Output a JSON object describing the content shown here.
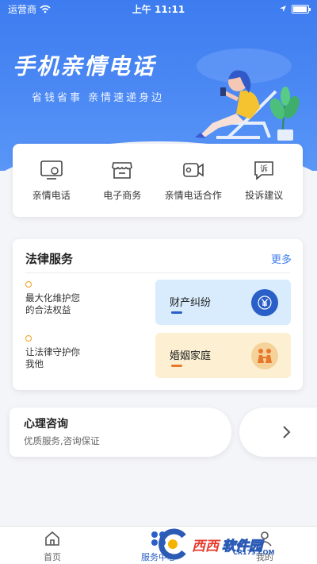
{
  "status_bar": {
    "carrier": "运营商",
    "time": "上午 11:11"
  },
  "hero": {
    "title": "手机亲情电话",
    "subtitle": "省钱省事  亲情速递身边"
  },
  "features": [
    {
      "label": "亲情电话",
      "icon": "tv-phone-icon"
    },
    {
      "label": "电子商务",
      "icon": "shop-icon"
    },
    {
      "label": "亲情电话合作",
      "icon": "video-camera-icon"
    },
    {
      "label": "投诉建议",
      "icon": "complaint-icon"
    }
  ],
  "legal": {
    "title": "法律服务",
    "more": "更多",
    "items": [
      {
        "text": "最大化维护您的合法权益"
      },
      {
        "text": "让法律守护你我他"
      }
    ],
    "pills": [
      {
        "label": "财产纠纷",
        "icon": "yen-icon",
        "bg": "#d8ecfd",
        "accent": "#2a5fc8"
      },
      {
        "label": "婚姻家庭",
        "icon": "couple-icon",
        "bg": "#fdf0d2",
        "accent": "#e8782a"
      }
    ]
  },
  "psych": {
    "title": "心理咨询",
    "subtitle": "优质服务,咨询保证"
  },
  "tabbar": {
    "tabs": [
      {
        "label": "首页",
        "icon": "home-icon"
      },
      {
        "label": "服务中心",
        "icon": "services-icon"
      },
      {
        "label": "我的",
        "icon": "user-icon"
      }
    ],
    "active": "服务中心"
  },
  "watermark": {
    "brand1": "西西",
    "brand2": "软件园",
    "url": "CR173.COM"
  },
  "colors": {
    "primary": "#3d7cf0",
    "accent_orange": "#f0a020",
    "tab_active": "#2a5fc8"
  }
}
